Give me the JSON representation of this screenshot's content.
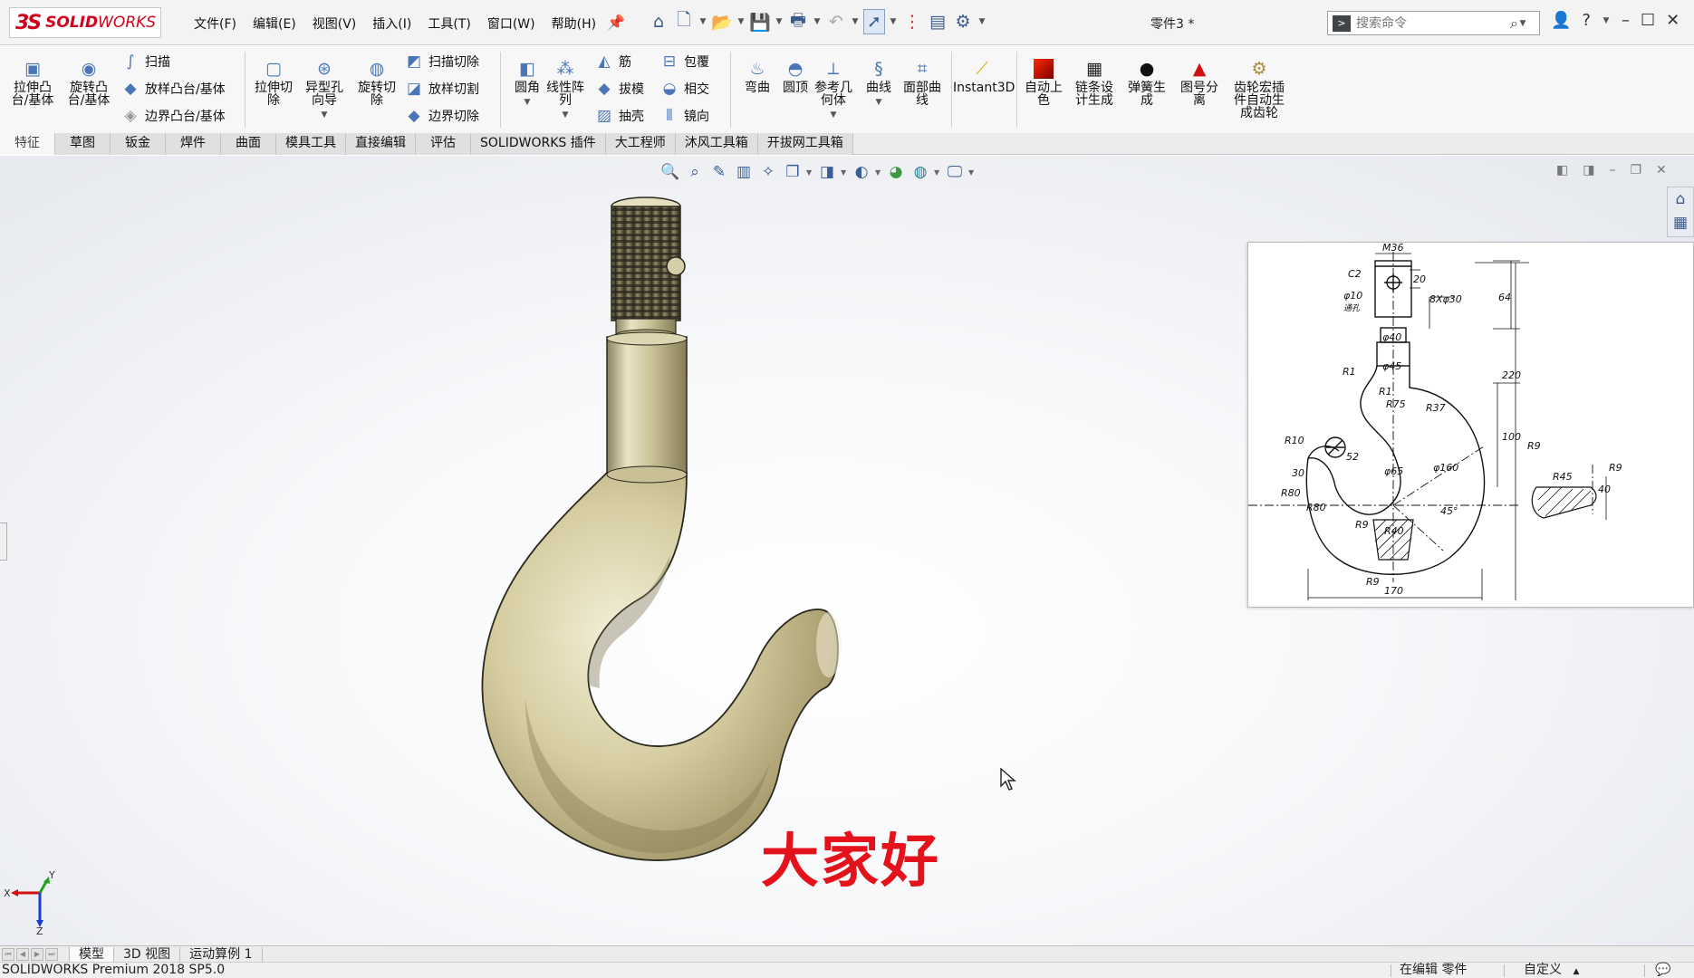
{
  "app": {
    "brand_ds": "3S",
    "brand_solid": "SOLID",
    "brand_works": "WORKS",
    "document_title": "零件3 *"
  },
  "menu": [
    "文件(F)",
    "编辑(E)",
    "视图(V)",
    "插入(I)",
    "工具(T)",
    "窗口(W)",
    "帮助(H)"
  ],
  "search": {
    "placeholder": "搜索命令"
  },
  "commands": {
    "extrude_boss": "拉伸凸\n台/基体",
    "revolve_boss": "旋转凸\n台/基体",
    "sweep": "扫描",
    "loft_boss": "放样凸台/基体",
    "boundary_boss": "边界凸台/基体",
    "extrude_cut": "拉伸切\n除",
    "hole_wizard": "异型孔\n向导",
    "revolve_cut": "旋转切\n除",
    "sweep_cut": "扫描切除",
    "loft_cut": "放样切割",
    "boundary_cut": "边界切除",
    "fillet": "圆角",
    "linear_pattern": "线性阵\n列",
    "rib": "筋",
    "draft": "拔模",
    "shell": "抽壳",
    "wrap": "包覆",
    "intersect": "相交",
    "mirror": "镜向",
    "flex": "弯曲",
    "dome": "圆顶",
    "reference_geometry": "参考几\n何体",
    "curves": "曲线",
    "face_curves": "面部曲\n线",
    "instant3d": "Instant3D",
    "auto_color": "自动上\n色",
    "chain_design": "链条设\n计生成",
    "spring": "弹簧生\n成",
    "balloon_separate": "图号分\n离",
    "gear_macro": "齿轮宏插\n件自动生\n成齿轮"
  },
  "tabs": [
    "特征",
    "草图",
    "钣金",
    "焊件",
    "曲面",
    "模具工具",
    "直接编辑",
    "评估",
    "SOLIDWORKS 插件",
    "大工程师",
    "沐风工具箱",
    "开拔网工具箱"
  ],
  "active_tab": 0,
  "overlay": {
    "greeting": "大家好"
  },
  "triad": {
    "x": "X",
    "y": "Y",
    "z": "Z"
  },
  "drawing": {
    "dims": {
      "m36": "M36",
      "c2": "C2",
      "d10": "φ10",
      "through": "通孔",
      "d20": "20",
      "bx30": "8Xφ30",
      "d64": "64",
      "d40": "φ40",
      "d45": "φ45",
      "r1a": "R1",
      "r1b": "R1",
      "r75": "R75",
      "r37": "R37",
      "d220": "220",
      "d100": "100",
      "r10": "R10",
      "d52": "52",
      "d65": "φ65",
      "d160": "φ160",
      "d30": "30",
      "r80a": "R80",
      "r80b": "R80",
      "r9a": "R9",
      "r40": "R40",
      "deg45": "45°",
      "r9b": "R9",
      "d170": "170",
      "r9c": "R9",
      "r9d": "R9",
      "d40b": "40",
      "r45": "R45"
    }
  },
  "bottom_tabs": [
    "模型",
    "3D 视图",
    "运动算例 1"
  ],
  "status": {
    "product": "SOLIDWORKS Premium 2018 SP5.0",
    "mode": "在编辑 零件",
    "units": "自定义",
    "units_arrow": "▲"
  },
  "colors": {
    "brand_red": "#d0021b",
    "hook_gold": "#c7bc8c",
    "greeting_red": "#e4131b"
  }
}
